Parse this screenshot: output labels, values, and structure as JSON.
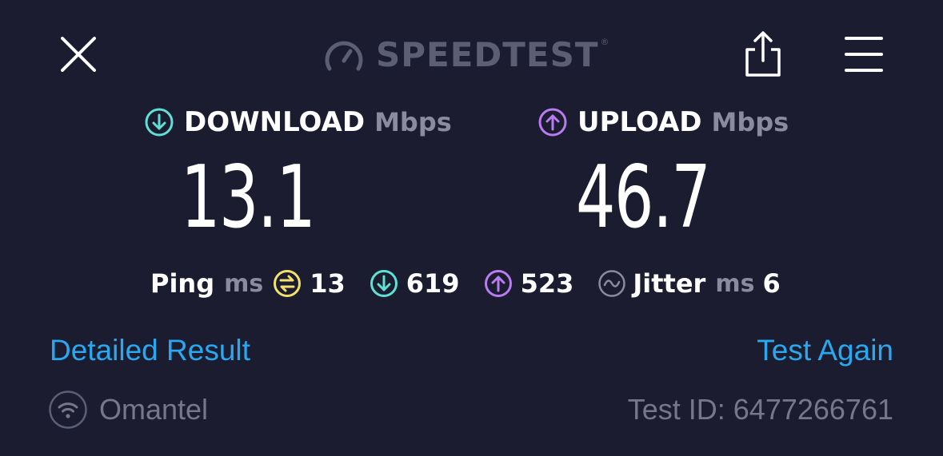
{
  "header": {
    "brand": "SPEEDTEST",
    "brand_mark": "®",
    "icons": [
      "close-icon",
      "speedometer-icon",
      "share-icon",
      "menu-icon"
    ]
  },
  "download": {
    "title": "DOWNLOAD",
    "unit": "Mbps",
    "value": "13.1",
    "color": "#5fe0d4"
  },
  "upload": {
    "title": "UPLOAD",
    "unit": "Mbps",
    "value": "46.7",
    "color": "#b97cf0"
  },
  "ping": {
    "label": "Ping",
    "unit": "ms",
    "idle_value": "13",
    "download_value": "619",
    "upload_value": "523",
    "idle_color": "#f2e16d"
  },
  "jitter": {
    "label": "Jitter",
    "unit": "ms",
    "value": "6"
  },
  "links": {
    "detailed": "Detailed Result",
    "again": "Test Again",
    "color": "#2aa8ef"
  },
  "footer": {
    "provider": "Omantel",
    "test_id": "Test ID: 6477266761"
  }
}
